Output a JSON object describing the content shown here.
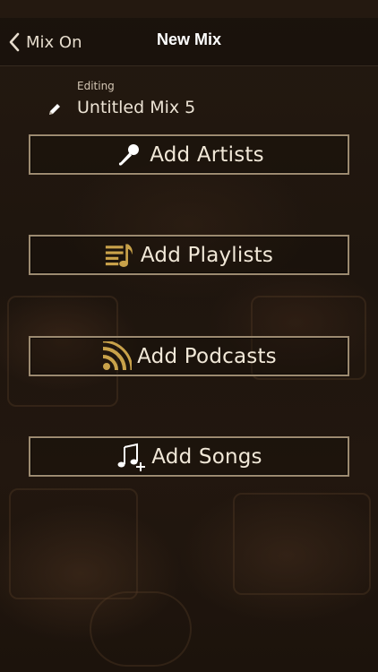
{
  "nav": {
    "back_label": "Mix On",
    "back_icon": "chevron-left-icon",
    "title": "New Mix"
  },
  "editor": {
    "caption": "Editing",
    "mix_name": "Untitled Mix 5",
    "edit_icon": "pencil-icon"
  },
  "actions": [
    {
      "label": "Add Artists",
      "icon": "microphone-icon"
    },
    {
      "label": "Add Playlists",
      "icon": "playlist-music-icon"
    },
    {
      "label": "Add Podcasts",
      "icon": "podcast-feed-icon"
    },
    {
      "label": "Add Songs",
      "icon": "add-song-icon"
    }
  ],
  "colors": {
    "accent_gold": "#c9a24a",
    "button_border": "#9c8a70",
    "background": "#1d140d",
    "text": "#f1e8d8"
  }
}
